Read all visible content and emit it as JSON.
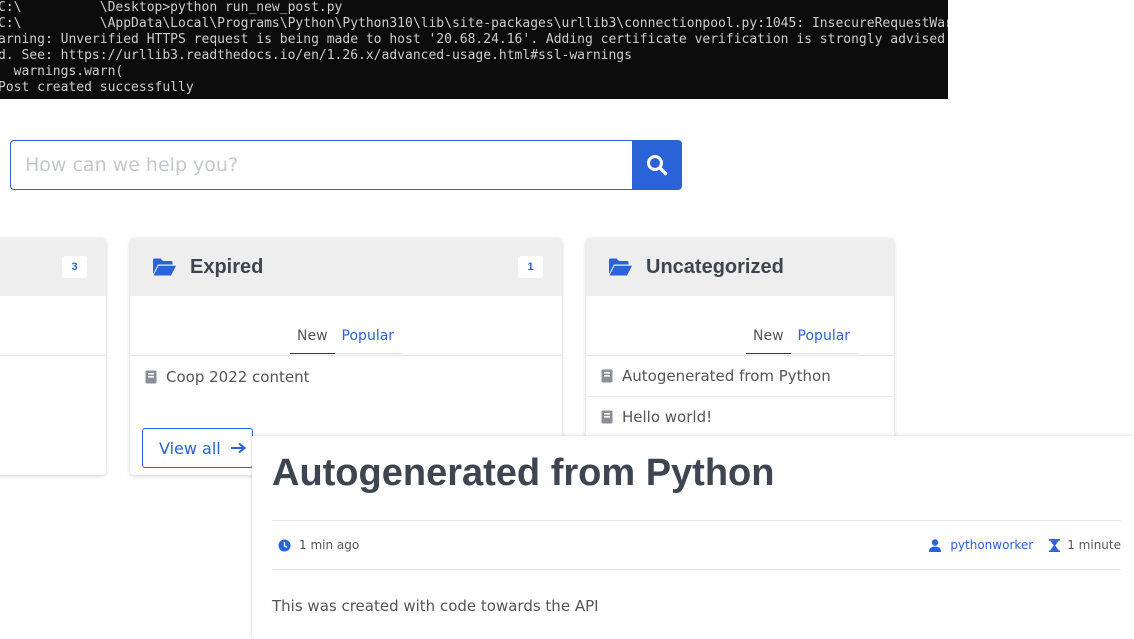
{
  "terminal": {
    "lines": [
      "C:\\          \\Desktop>python run_new_post.py",
      "C:\\          \\AppData\\Local\\Programs\\Python\\Python310\\lib\\site-packages\\urllib3\\connectionpool.py:1045: InsecureRequestWarning",
      "arning: Unverified HTTPS request is being made to host '20.68.24.16'. Adding certificate verification is strongly advised.",
      "d. See: https://urllib3.readthedocs.io/en/1.26.x/advanced-usage.html#ssl-warnings",
      "  warnings.warn(",
      "Post created successfully"
    ]
  },
  "search": {
    "placeholder": "How can we help you?",
    "icon": "search-icon"
  },
  "categories": [
    {
      "title": "",
      "count": "3",
      "tabs": [],
      "items": [],
      "view_all": ""
    },
    {
      "title": "Expired",
      "count": "1",
      "tabs": [
        "New",
        "Popular"
      ],
      "items": [
        "Coop 2022 content"
      ],
      "view_all": "View all"
    },
    {
      "title": "Uncategorized",
      "count": "",
      "tabs": [
        "New",
        "Popular"
      ],
      "items": [
        "Autogenerated from Python",
        "Hello world!"
      ],
      "view_all": ""
    }
  ],
  "post": {
    "title": "Autogenerated from Python",
    "time_ago": "1 min ago",
    "author": "pythonworker",
    "read_time": "1 minute",
    "body": "This was created with code towards the API"
  },
  "colors": {
    "accent": "#2a62d8",
    "heading": "#3d4551",
    "terminal_bg": "#0c0c0c",
    "terminal_text": "#cccccc",
    "card_header": "#eeeeee"
  }
}
